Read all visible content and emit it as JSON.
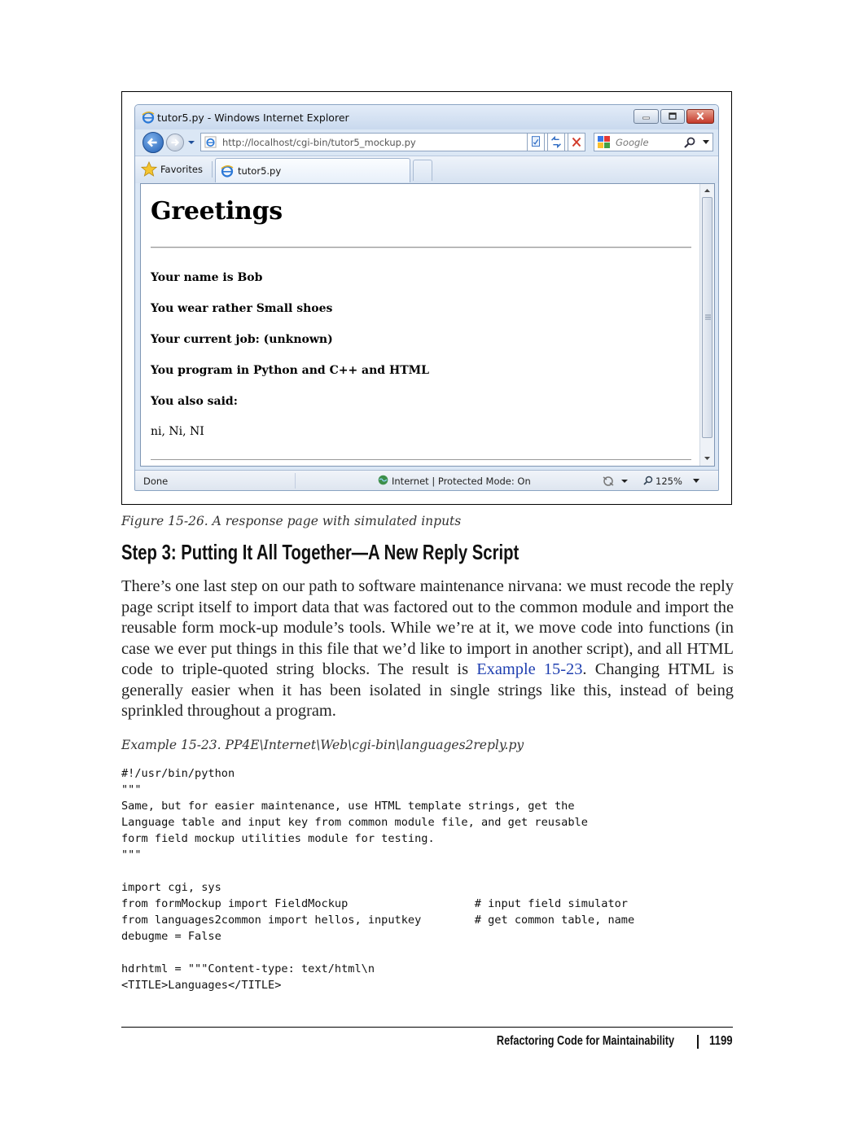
{
  "figure": {
    "browser": {
      "window_title": "tutor5.py - Windows Internet Explorer",
      "address": "http://localhost/cgi-bin/tutor5_mockup.py",
      "search_placeholder": "Google",
      "favorites_label": "Favorites",
      "tab_label": "tutor5.py",
      "page": {
        "heading": "Greetings",
        "lines": [
          "Your name is Bob",
          "You wear rather Small shoes",
          "Your current job: (unknown)",
          "You program in Python and C++ and HTML",
          "You also said:",
          "ni, Ni, NI"
        ]
      },
      "status": {
        "left": "Done",
        "zone": "Internet | Protected Mode: On",
        "zoom": "125%"
      }
    },
    "caption": "Figure 15-26. A response page with simulated inputs"
  },
  "section": {
    "heading": "Step 3: Putting It All Together—A New Reply Script",
    "para_before_link": "There’s one last step on our path to software maintenance nirvana: we must recode the reply page script itself to import data that was factored out to the common module and import the reusable form mock-up module’s tools. While we’re at it, we move code into functions (in case we ever put things in this file that we’d like to import in another script), and all HTML code to triple-quoted string blocks. The result is ",
    "link_text": "Example 15-23",
    "para_after_link": ". Changing HTML is generally easier when it has been isolated in single strings like this, instead of being sprinkled throughout a program."
  },
  "example": {
    "caption": "Example 15-23. PP4E\\Internet\\Web\\cgi-bin\\languages2reply.py",
    "code": "#!/usr/bin/python\n\"\"\"\nSame, but for easier maintenance, use HTML template strings, get the\nLanguage table and input key from common module file, and get reusable\nform field mockup utilities module for testing.\n\"\"\"\n\nimport cgi, sys\nfrom formMockup import FieldMockup                   # input field simulator\nfrom languages2common import hellos, inputkey        # get common table, name\ndebugme = False\n\nhdrhtml = \"\"\"Content-type: text/html\\n\n<TITLE>Languages</TITLE>"
  },
  "footer": {
    "running_title": "Refactoring Code for Maintainability",
    "page_number": "1199"
  }
}
